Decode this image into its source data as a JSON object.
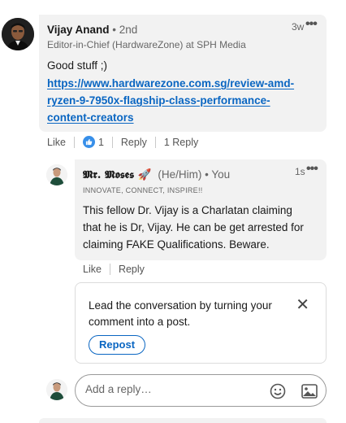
{
  "comment": {
    "author_name": "Vijay Anand",
    "degree": "• 2nd",
    "headline": "Editor-in-Chief (HardwareZone) at SPH Media",
    "time": "3w",
    "more": "•••",
    "text_line1": "Good stuff ;)",
    "link_line1": "https://www.hardwarezone.com.sg/review-amd-",
    "link_line2": "ryzen-9-7950x-flagship-class-performance-",
    "link_line3": "content-creators",
    "actions": {
      "like_label": "Like",
      "reaction_count": "1",
      "reply_label": "Reply",
      "replies_count": "1 Reply"
    }
  },
  "reply": {
    "author_name": "𝕸𝖗. 𝕸𝖔𝖘𝖊𝖘 🚀",
    "pronouns": "(He/Him) • You",
    "headline": "INNOVATE, CONNECT, INSPIRE!!",
    "time": "1s",
    "more": "•••",
    "text_line1": "This fellow Dr. Vijay is a Charlatan claiming",
    "text_line2": "that he is Dr, Vijay. He can be get arrested for",
    "text_line3": "claiming FAKE Qualifications. Beware.",
    "actions": {
      "like_label": "Like",
      "reply_label": "Reply"
    }
  },
  "repost_card": {
    "line1": "Lead the conversation by turning your",
    "line2": "comment into a post.",
    "close": "✕",
    "button_label": "Repost"
  },
  "reply_box": {
    "placeholder": "Add a reply…"
  },
  "colors": {
    "accent": "#0a66c2",
    "bubble": "#f2f2f2",
    "like_badge": "#378fe9"
  }
}
